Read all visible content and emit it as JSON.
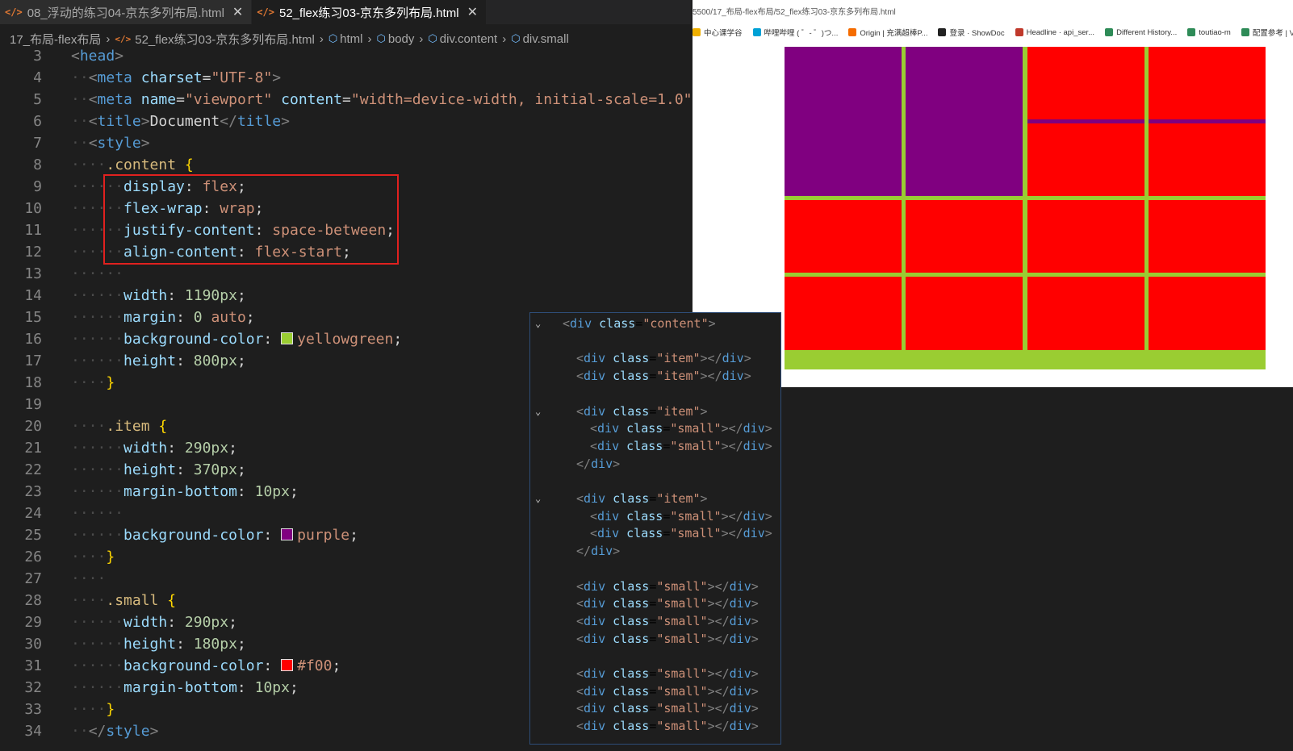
{
  "tabs": [
    {
      "icon": "</>",
      "label": "08_浮动的练习04-京东多列布局.html",
      "active": false
    },
    {
      "icon": "</>",
      "label": "52_flex练习03-京东多列布局.html",
      "active": true
    }
  ],
  "breadcrumb": [
    "17_布局-flex布局",
    "52_flex练习03-京东多列布局.html",
    "html",
    "body",
    "div.content",
    "div.small"
  ],
  "code_lines": [
    {
      "n": "3",
      "html": "<span class='p'>&lt;</span><span class='t'>head</span><span class='p'>&gt;</span>",
      "indent": 0
    },
    {
      "n": "4",
      "html": "<span class='dots'>··</span><span class='p'>&lt;</span><span class='t'>meta</span> <span class='a'>charset</span>=<span class='s'>\"UTF-8\"</span><span class='p'>&gt;</span>"
    },
    {
      "n": "5",
      "html": "<span class='dots'>··</span><span class='p'>&lt;</span><span class='t'>meta</span> <span class='a'>name</span>=<span class='s'>\"viewport\"</span> <span class='a'>content</span>=<span class='s'>\"width=device-width, initial-scale=1.0\"</span>"
    },
    {
      "n": "6",
      "html": "<span class='dots'>··</span><span class='p'>&lt;</span><span class='t'>title</span><span class='p'>&gt;</span><span class='txt'>Document</span><span class='p'>&lt;/</span><span class='t'>title</span><span class='p'>&gt;</span>"
    },
    {
      "n": "7",
      "html": "<span class='dots'>··</span><span class='p'>&lt;</span><span class='t'>style</span><span class='p'>&gt;</span>"
    },
    {
      "n": "8",
      "html": "<span class='dots'>····</span><span class='sel'>.content</span> <span class='br'>{</span>"
    },
    {
      "n": "9",
      "html": "<span class='dots'>······</span><span class='prop'>display</span>: <span class='val'>flex</span>;"
    },
    {
      "n": "10",
      "html": "<span class='dots'>······</span><span class='prop'>flex-wrap</span>: <span class='val'>wrap</span>;"
    },
    {
      "n": "11",
      "html": "<span class='dots'>······</span><span class='prop'>justify-content</span>: <span class='val'>space-between</span>;"
    },
    {
      "n": "12",
      "html": "<span class='dots'>······</span><span class='prop'>align-content</span>: <span class='val'>flex-start</span>;"
    },
    {
      "n": "13",
      "html": "<span class='dots'>······</span>"
    },
    {
      "n": "14",
      "html": "<span class='dots'>······</span><span class='prop'>width</span>: <span class='num'>1190px</span>;"
    },
    {
      "n": "15",
      "html": "<span class='dots'>······</span><span class='prop'>margin</span>: <span class='num'>0</span> <span class='val'>auto</span>;"
    },
    {
      "n": "16",
      "html": "<span class='dots'>······</span><span class='prop'>background-color</span>: <span class='swatch' style='background:#9acd32'></span><span class='val'>yellowgreen</span>;"
    },
    {
      "n": "17",
      "html": "<span class='dots'>······</span><span class='prop'>height</span>: <span class='num'>800px</span>;"
    },
    {
      "n": "18",
      "html": "<span class='dots'>····</span><span class='br'>}</span>"
    },
    {
      "n": "19",
      "html": ""
    },
    {
      "n": "20",
      "html": "<span class='dots'>····</span><span class='sel'>.item</span> <span class='br'>{</span>"
    },
    {
      "n": "21",
      "html": "<span class='dots'>······</span><span class='prop'>width</span>: <span class='num'>290px</span>;"
    },
    {
      "n": "22",
      "html": "<span class='dots'>······</span><span class='prop'>height</span>: <span class='num'>370px</span>;"
    },
    {
      "n": "23",
      "html": "<span class='dots'>······</span><span class='prop'>margin-bottom</span>: <span class='num'>10px</span>;"
    },
    {
      "n": "24",
      "html": "<span class='dots'>······</span>"
    },
    {
      "n": "25",
      "html": "<span class='dots'>······</span><span class='prop'>background-color</span>: <span class='swatch' style='background:#800080'></span><span class='val'>purple</span>;"
    },
    {
      "n": "26",
      "html": "<span class='dots'>····</span><span class='br'>}</span>"
    },
    {
      "n": "27",
      "html": "<span class='dots'>····</span>"
    },
    {
      "n": "28",
      "html": "<span class='dots'>····</span><span class='sel'>.small</span> <span class='br'>{</span>"
    },
    {
      "n": "29",
      "html": "<span class='dots'>······</span><span class='prop'>width</span>: <span class='num'>290px</span>;"
    },
    {
      "n": "30",
      "html": "<span class='dots'>······</span><span class='prop'>height</span>: <span class='num'>180px</span>;"
    },
    {
      "n": "31",
      "html": "<span class='dots'>······</span><span class='prop'>background-color</span>: <span class='swatch' style='background:#ff0000'></span><span class='val'>#f00</span>;"
    },
    {
      "n": "32",
      "html": "<span class='dots'>······</span><span class='prop'>margin-bottom</span>: <span class='num'>10px</span>;"
    },
    {
      "n": "33",
      "html": "<span class='dots'>····</span><span class='br'>}</span>"
    },
    {
      "n": "34",
      "html": "<span class='dots'>··</span><span class='p'>&lt;/</span><span class='t'>style</span><span class='p'>&gt;</span>"
    }
  ],
  "browser": {
    "url": "5500/17_布局-flex布局/52_flex练习03-京东多列布局.html",
    "bookmarks": [
      {
        "label": "中心课学谷",
        "color": "#f0b000"
      },
      {
        "label": "哔哩哔哩 ( ゜- ゜)つ...",
        "color": "#00a1d6"
      },
      {
        "label": "Origin | 充满超棒P...",
        "color": "#f56c00"
      },
      {
        "label": "登录 · ShowDoc",
        "color": "#222222"
      },
      {
        "label": "Headline · api_ser...",
        "color": "#c0392b"
      },
      {
        "label": "Different History...",
        "color": "#2e8b57"
      },
      {
        "label": "toutiao-m",
        "color": "#2e8b57"
      },
      {
        "label": "配置参考 | Vue",
        "color": "#2e8b57"
      }
    ]
  },
  "colors": {
    "purple": "#800080",
    "red": "#ff0000",
    "yellowgreen": "#9acd32"
  },
  "outline": [
    {
      "chev": true,
      "html": "<span class='p'>&lt;</span><span class='t'>div</span> <span class='a'>class</span>=<span class='s'>\"content\"</span><span class='p'>&gt;</span>",
      "lvl": 0
    },
    {
      "chev": false,
      "html": "",
      "lvl": 1
    },
    {
      "chev": false,
      "html": "<span class='p'>&lt;</span><span class='t'>div</span> <span class='a'>class</span>=<span class='s'>\"item\"</span><span class='p'>&gt;&lt;/</span><span class='t'>div</span><span class='p'>&gt;</span>",
      "lvl": 1
    },
    {
      "chev": false,
      "html": "<span class='p'>&lt;</span><span class='t'>div</span> <span class='a'>class</span>=<span class='s'>\"item\"</span><span class='p'>&gt;&lt;/</span><span class='t'>div</span><span class='p'>&gt;</span>",
      "lvl": 1
    },
    {
      "chev": false,
      "html": "",
      "lvl": 1
    },
    {
      "chev": true,
      "html": "<span class='p'>&lt;</span><span class='t'>div</span> <span class='a'>class</span>=<span class='s'>\"item\"</span><span class='p'>&gt;</span>",
      "lvl": 1
    },
    {
      "chev": false,
      "html": "<span class='p'>&lt;</span><span class='t'>div</span> <span class='a'>class</span>=<span class='s'>\"small\"</span><span class='p'>&gt;&lt;/</span><span class='t'>div</span><span class='p'>&gt;</span>",
      "lvl": 2
    },
    {
      "chev": false,
      "html": "<span class='p'>&lt;</span><span class='t'>div</span> <span class='a'>class</span>=<span class='s'>\"small\"</span><span class='p'>&gt;&lt;/</span><span class='t'>div</span><span class='p'>&gt;</span>",
      "lvl": 2
    },
    {
      "chev": false,
      "html": "<span class='p'>&lt;/</span><span class='t'>div</span><span class='p'>&gt;</span>",
      "lvl": 1
    },
    {
      "chev": false,
      "html": "",
      "lvl": 1
    },
    {
      "chev": true,
      "html": "<span class='p'>&lt;</span><span class='t'>div</span> <span class='a'>class</span>=<span class='s'>\"item\"</span><span class='p'>&gt;</span>",
      "lvl": 1
    },
    {
      "chev": false,
      "html": "<span class='p'>&lt;</span><span class='t'>div</span> <span class='a'>class</span>=<span class='s'>\"small\"</span><span class='p'>&gt;&lt;/</span><span class='t'>div</span><span class='p'>&gt;</span>",
      "lvl": 2
    },
    {
      "chev": false,
      "html": "<span class='p'>&lt;</span><span class='t'>div</span> <span class='a'>class</span>=<span class='s'>\"small\"</span><span class='p'>&gt;&lt;/</span><span class='t'>div</span><span class='p'>&gt;</span>",
      "lvl": 2
    },
    {
      "chev": false,
      "html": "<span class='p'>&lt;/</span><span class='t'>div</span><span class='p'>&gt;</span>",
      "lvl": 1
    },
    {
      "chev": false,
      "html": "",
      "lvl": 1
    },
    {
      "chev": false,
      "html": "<span class='p'>&lt;</span><span class='t'>div</span> <span class='a'>class</span>=<span class='s'>\"small\"</span><span class='p'>&gt;&lt;/</span><span class='t'>div</span><span class='p'>&gt;</span>",
      "lvl": 1
    },
    {
      "chev": false,
      "html": "<span class='p'>&lt;</span><span class='t'>div</span> <span class='a'>class</span>=<span class='s'>\"small\"</span><span class='p'>&gt;&lt;/</span><span class='t'>div</span><span class='p'>&gt;</span>",
      "lvl": 1
    },
    {
      "chev": false,
      "html": "<span class='p'>&lt;</span><span class='t'>div</span> <span class='a'>class</span>=<span class='s'>\"small\"</span><span class='p'>&gt;&lt;/</span><span class='t'>div</span><span class='p'>&gt;</span>",
      "lvl": 1
    },
    {
      "chev": false,
      "html": "<span class='p'>&lt;</span><span class='t'>div</span> <span class='a'>class</span>=<span class='s'>\"small\"</span><span class='p'>&gt;&lt;/</span><span class='t'>div</span><span class='p'>&gt;</span>",
      "lvl": 1
    },
    {
      "chev": false,
      "html": "",
      "lvl": 1
    },
    {
      "chev": false,
      "html": "<span class='p'>&lt;</span><span class='t'>div</span> <span class='a'>class</span>=<span class='s'>\"small\"</span><span class='p'>&gt;&lt;/</span><span class='t'>div</span><span class='p'>&gt;</span>",
      "lvl": 1
    },
    {
      "chev": false,
      "html": "<span class='p'>&lt;</span><span class='t'>div</span> <span class='a'>class</span>=<span class='s'>\"small\"</span><span class='p'>&gt;&lt;/</span><span class='t'>div</span><span class='p'>&gt;</span>",
      "lvl": 1
    },
    {
      "chev": false,
      "html": "<span class='p'>&lt;</span><span class='t'>div</span> <span class='a'>class</span>=<span class='s'>\"small\"</span><span class='p'>&gt;&lt;/</span><span class='t'>div</span><span class='p'>&gt;</span>",
      "lvl": 1
    },
    {
      "chev": false,
      "html": "<span class='p'>&lt;</span><span class='t'>div</span> <span class='a'>class</span>=<span class='s'>\"small\"</span><span class='p'>&gt;&lt;/</span><span class='t'>div</span><span class='p'>&gt;</span>",
      "lvl": 1
    }
  ]
}
